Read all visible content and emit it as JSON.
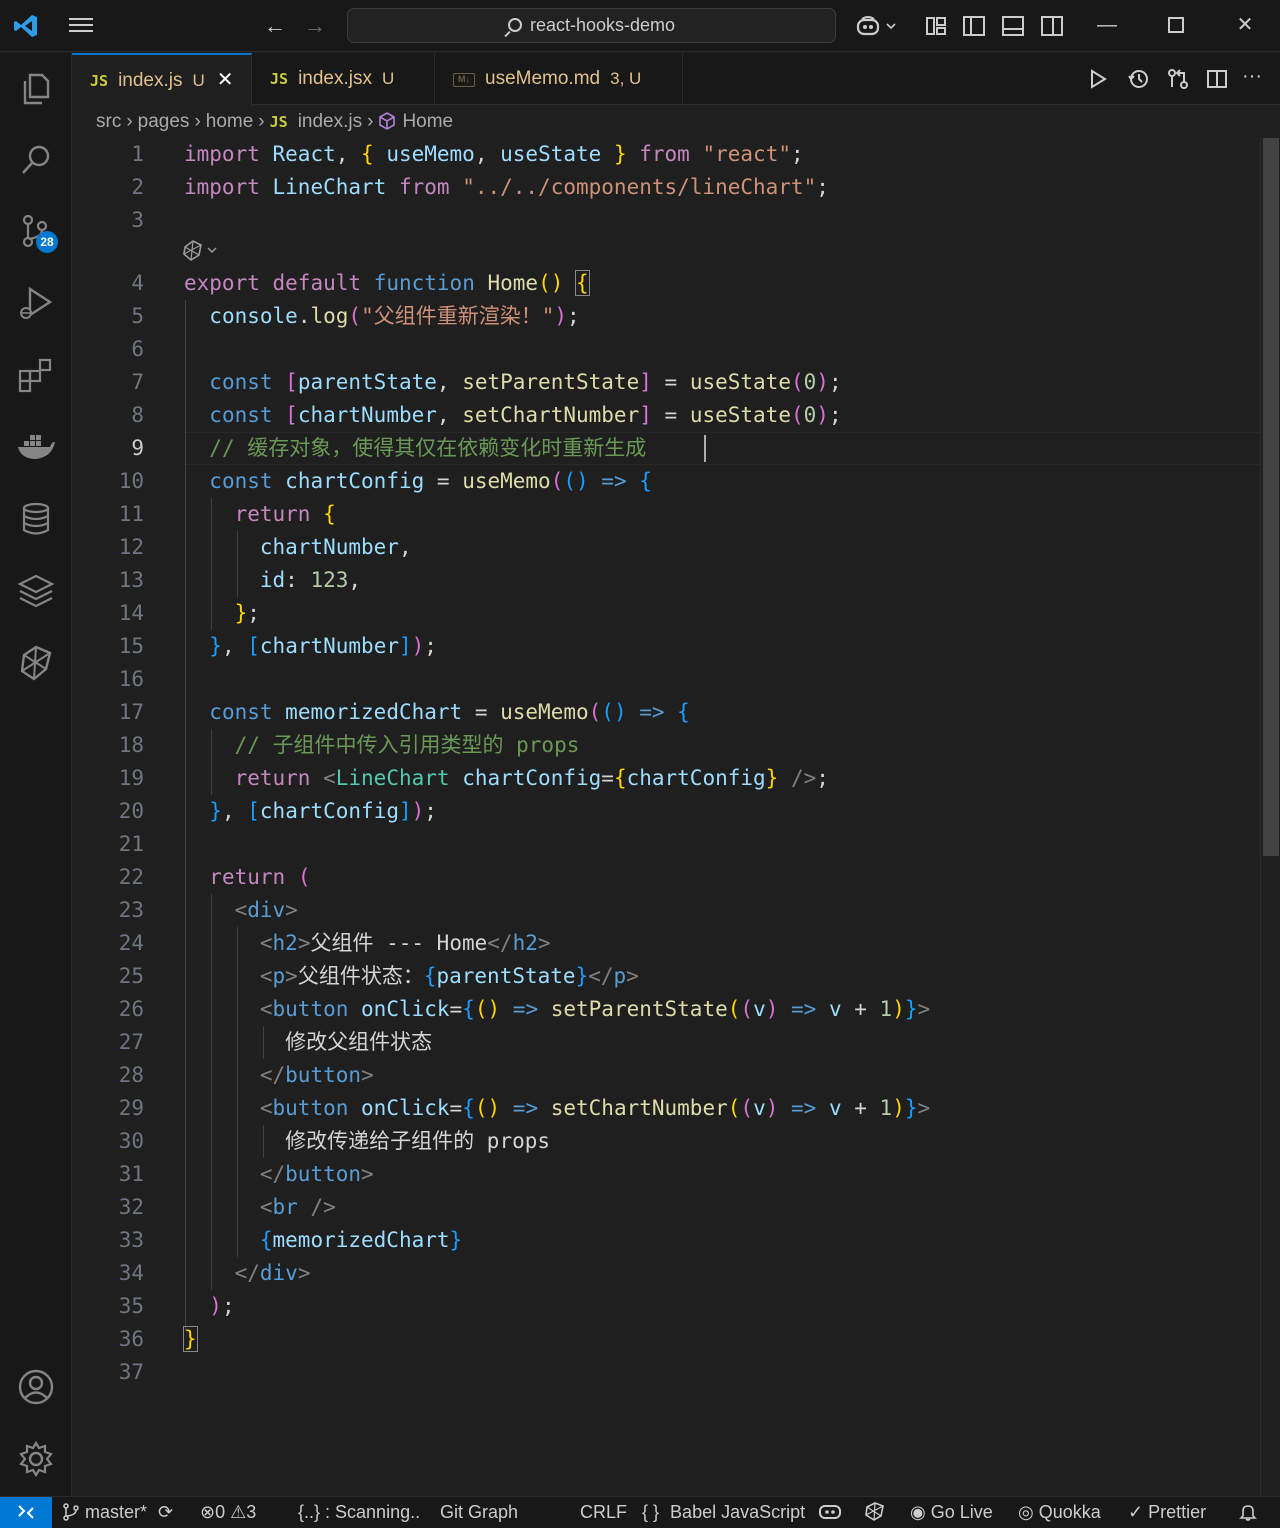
{
  "window": {
    "title": "react-hooks-demo"
  },
  "tabs": [
    {
      "icon": "JS",
      "name": "index.js",
      "status": "U",
      "close": "✕"
    },
    {
      "icon": "JS",
      "name": "index.jsx",
      "status": "U"
    },
    {
      "icon": "M↓",
      "name": "useMemo.md",
      "status": "3, U"
    }
  ],
  "breadcrumb": {
    "items": [
      "src",
      "pages",
      "home"
    ],
    "file_icon": "JS",
    "file": "index.js",
    "symbol": "Home"
  },
  "activity": {
    "scm_badge": "28"
  },
  "line_numbers": [
    "1",
    "2",
    "3",
    "4",
    "5",
    "6",
    "7",
    "8",
    "9",
    "10",
    "11",
    "12",
    "13",
    "14",
    "15",
    "16",
    "17",
    "18",
    "19",
    "20",
    "21",
    "22",
    "23",
    "24",
    "25",
    "26",
    "27",
    "28",
    "29",
    "30",
    "31",
    "32",
    "33",
    "34",
    "35",
    "36",
    "37"
  ],
  "code": {
    "l1": [
      "import",
      "React",
      ", ",
      "{ ",
      "useMemo",
      ", ",
      "useState",
      " }",
      "from",
      "\"react\"",
      ";"
    ],
    "l2": [
      "import",
      "LineChart",
      "from",
      "\"../../components/lineChart\"",
      ";"
    ],
    "l4": [
      "export",
      "default",
      "function",
      "Home",
      "()",
      "{"
    ],
    "l5": [
      "console",
      ".",
      "log",
      "(",
      "\"父组件重新渲染！\"",
      ")",
      ";"
    ],
    "l7": [
      "const",
      "[",
      "parentState",
      ", ",
      "setParentState",
      "]",
      " = ",
      "useState",
      "(",
      "0",
      ")",
      ";"
    ],
    "l8": [
      "const",
      "[",
      "chartNumber",
      ", ",
      "setChartNumber",
      "]",
      " = ",
      "useState",
      "(",
      "0",
      ")",
      ";"
    ],
    "l9": "// 缓存对象，使得其仅在依赖变化时重新生成",
    "l10": [
      "const",
      "chartConfig",
      " = ",
      "useMemo",
      "(",
      "()",
      " => ",
      "{"
    ],
    "l11": [
      "return",
      "{"
    ],
    "l12": [
      "chartNumber",
      ","
    ],
    "l13": [
      "id",
      ": ",
      "123",
      ","
    ],
    "l14": [
      "}",
      ";"
    ],
    "l15": [
      "}",
      ", ",
      "[",
      "chartNumber",
      "]",
      ")",
      ";"
    ],
    "l17": [
      "const",
      "memorizedChart",
      " = ",
      "useMemo",
      "(",
      "()",
      " => ",
      "{"
    ],
    "l18": "// 子组件中传入引用类型的 props",
    "l19": [
      "return",
      "<",
      "LineChart",
      "chartConfig",
      "=",
      "{",
      "chartConfig",
      "}",
      " />",
      ";"
    ],
    "l20": [
      "}",
      ", ",
      "[",
      "chartConfig",
      "]",
      ")",
      ";"
    ],
    "l22": [
      "return",
      "("
    ],
    "l23": [
      "<",
      "div",
      ">"
    ],
    "l24": [
      "<",
      "h2",
      ">",
      "父组件 --- Home",
      "</",
      "h2",
      ">"
    ],
    "l25": [
      "<",
      "p",
      ">",
      "父组件状态：",
      "{",
      "parentState",
      "}",
      "</",
      "p",
      ">"
    ],
    "l26": [
      "<",
      "button",
      "onClick",
      "=",
      "{",
      "()",
      " => ",
      "setParentState",
      "(",
      "(",
      "v",
      ")",
      " => ",
      "v",
      " + ",
      "1",
      ")",
      "}",
      ">"
    ],
    "l27": "修改父组件状态",
    "l28": [
      "</",
      "button",
      ">"
    ],
    "l29": [
      "<",
      "button",
      "onClick",
      "=",
      "{",
      "()",
      " => ",
      "setChartNumber",
      "(",
      "(",
      "v",
      ")",
      " => ",
      "v",
      " + ",
      "1",
      ")",
      "}",
      ">"
    ],
    "l30": "修改传递给子组件的 props",
    "l31": [
      "</",
      "button",
      ">"
    ],
    "l32": [
      "<",
      "br",
      " />"
    ],
    "l33": [
      "{",
      "memorizedChart",
      "}"
    ],
    "l34": [
      "</",
      "div",
      ">"
    ],
    "l35": [
      ")",
      ";"
    ],
    "l36": "}"
  },
  "statusbar": {
    "branch": "master*",
    "errors": "0",
    "warnings": "3",
    "scanning": "{..} : Scanning..",
    "git_graph": "Git Graph",
    "eol": "CRLF",
    "language_icon": "{ }",
    "language": "Babel JavaScript",
    "go_live": "Go Live",
    "quokka": "Quokka",
    "prettier": "Prettier"
  },
  "colors": {
    "accent": "#0078d4",
    "keyword": "#c586c0",
    "storage": "#569cd6",
    "variable": "#9cdcfe",
    "function": "#dcdcaa",
    "string": "#ce9178",
    "comment": "#6a9955",
    "component": "#4ec9b0"
  }
}
